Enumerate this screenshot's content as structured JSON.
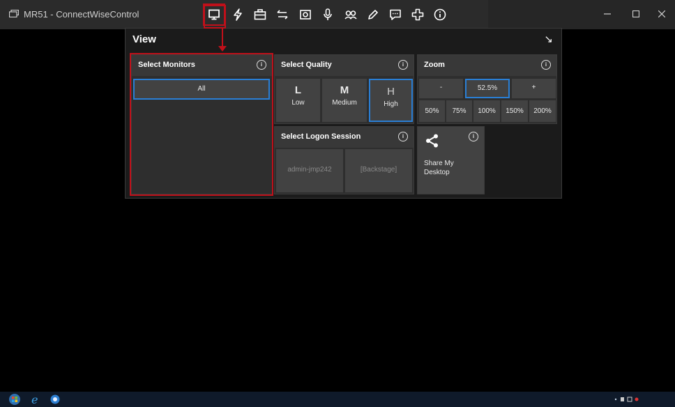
{
  "window": {
    "title": "MR51 - ConnectWiseControl"
  },
  "toolbar": {
    "icons": [
      "view-monitor-icon",
      "lightning-icon",
      "toolbox-icon",
      "transfer-icon",
      "screenshot-camera-icon",
      "microphone-icon",
      "participants-icon",
      "pencil-icon",
      "chat-icon",
      "plus-cross-icon",
      "info-icon"
    ]
  },
  "panel": {
    "title": "View",
    "collapse_glyph": "↘",
    "monitors": {
      "heading": "Select Monitors",
      "button": "All"
    },
    "quality": {
      "heading": "Select Quality",
      "options": [
        {
          "letter": "L",
          "label": "Low",
          "selected": false
        },
        {
          "letter": "M",
          "label": "Medium",
          "selected": false
        },
        {
          "letter": "H",
          "label": "High",
          "selected": true
        }
      ]
    },
    "zoom": {
      "heading": "Zoom",
      "minus": "-",
      "value": "52.5%",
      "plus": "+",
      "presets": [
        "50%",
        "75%",
        "100%",
        "150%",
        "200%"
      ]
    },
    "logon": {
      "heading": "Select Logon Session",
      "sessions": [
        "admin-jmp242",
        "[Backstage]"
      ]
    },
    "share": {
      "label_line1": "Share My",
      "label_line2": "Desktop"
    }
  },
  "colors": {
    "highlight_red": "#c0101a",
    "selected_blue": "#2a7fd6",
    "panel_bg": "#1b1b1b"
  }
}
